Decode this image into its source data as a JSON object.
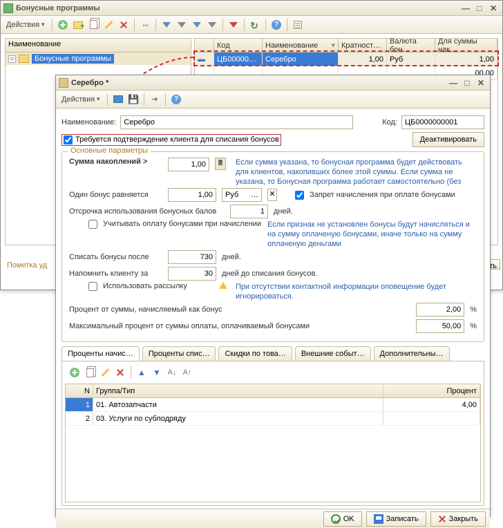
{
  "bgWindow": {
    "title": "Бонусные программы",
    "toolbar": {
      "actions": "Действия"
    },
    "treeHeader": "Наименование",
    "treeRoot": "Бонусные программы",
    "gridCols": {
      "code": "Код",
      "name": "Наименование",
      "mult": "Кратност…",
      "curr": "Валюта бон…",
      "sum": "Для суммы нак…"
    },
    "row1": {
      "code": "ЦБ00000…",
      "name": "Серебро",
      "mult": "1,00",
      "curr": "Руб",
      "sum": "1,00"
    },
    "row2sum": "00,00",
    "markLabel": "Пометка уд",
    "closeBtn": "крыть"
  },
  "fgWindow": {
    "title": "Серебро *",
    "toolbar": {
      "actions": "Действия"
    },
    "nameLabel": "Наименование:",
    "nameValue": "Серебро",
    "codeLabel": "Код:",
    "codeValue": "ЦБ0000000001",
    "confirmLabel": "Требуется подтверждение клиента для списания бонусов",
    "deactivate": "Деактивировать",
    "fieldset": {
      "legend": "Основные параметры",
      "sumLabel": "Сумма накоплений  >",
      "sumValue": "1,00",
      "sumNote": "Если сумма указана, то бонусная программа будет действовать для клиентов, накопивших более этой суммы. Если сумма не указана, то Бонусная программа работает самостоятельно (без",
      "oneBonusLabel": "Один бонус равняется",
      "oneBonusValue": "1,00",
      "oneBonusUnit": "Руб",
      "forbidLabel": "Запрет начисления при оплате бонусами",
      "delayLabel": "Отсрочка использования бонусных балов",
      "delayValue": "1",
      "daysUnit": "дней.",
      "considerLabel": "Учитывать оплату бонусами при начислении",
      "considerNote": "Если признак не установлен бонусы будут начисляться и на сумму оплаченую бонусами, иначе только на сумму оплаченую деньгами",
      "writeOffLabel": "Списать бонусы после",
      "writeOffValue": "730",
      "remindLabel": "Напомнить клиенту за",
      "remindValue": "30",
      "remindUnit": "дней до списания бонусов.",
      "mailingLabel": "Использовать рассылку",
      "mailingNote": "При отсутствии контактной информации оповещение будет игнорироваться.",
      "pctLabel": "Процент от суммы, начисляемый как бонус",
      "pctValue": "2,00",
      "maxPctLabel": "Максимальный процент от суммы оплаты, оплачиваемый бонусами",
      "maxPctValue": "50,00",
      "pctUnit": "%"
    },
    "tabs": {
      "t1": "Проценты начис…",
      "t2": "Проценты спис…",
      "t3": "Скидки по това…",
      "t4": "Внешние событ…",
      "t5": "Дополнительны…"
    },
    "subtable": {
      "colN": "N",
      "colGroup": "Группа/Тип",
      "colPct": "Процент",
      "r1": {
        "n": "1",
        "grp": "01. Автозапчасти",
        "pct": "4,00"
      },
      "r2": {
        "n": "2",
        "grp": "03. Услуги по субподряду",
        "pct": ""
      }
    },
    "footer": {
      "ok": "OK",
      "save": "Записать",
      "close": "Закрыть"
    }
  }
}
